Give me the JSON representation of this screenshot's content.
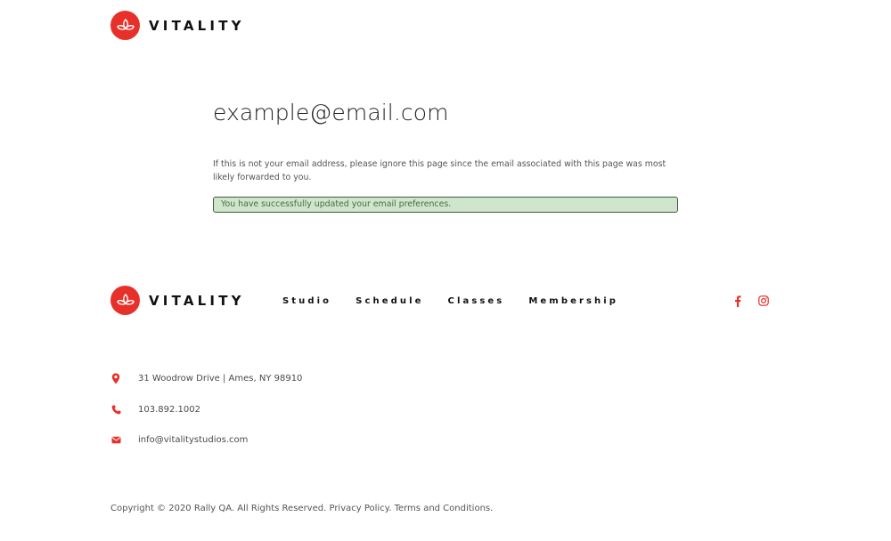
{
  "brand": {
    "name": "VITALITY",
    "accent_color": "#e8302a",
    "logo_icon": "lotus-icon"
  },
  "main": {
    "email": "example@email.com",
    "notice": "If this is not your email address, please ignore this page since the email associated with this page was most likely forwarded to you.",
    "success_message": "You have successfully updated your email preferences.",
    "success_bg": "#cfe6cd"
  },
  "footer": {
    "nav": {
      "studio": "Studio",
      "schedule": "Schedule",
      "classes": "Classes",
      "membership": "Membership"
    },
    "social": [
      "facebook-icon",
      "instagram-icon"
    ],
    "contact": {
      "address": "31 Woodrow Drive | Ames, NY 98910",
      "phone": "103.892.1002",
      "email": "info@vitalitystudios.com"
    },
    "copyright": "Copyright © 2020 Rally QA. All Rights Reserved.",
    "privacy_link": "Privacy Policy.",
    "terms_link": "Terms and Conditions."
  }
}
